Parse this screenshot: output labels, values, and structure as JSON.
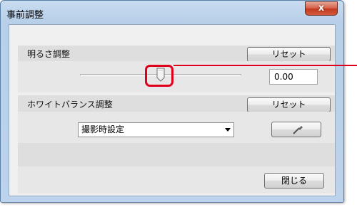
{
  "window": {
    "title": "事前調整",
    "close_label": "x"
  },
  "brightness": {
    "label": "明るさ調整",
    "reset_label": "リセット",
    "value": "0.00",
    "slider_position": 0.5
  },
  "white_balance": {
    "label": "ホワイトバランス調整",
    "reset_label": "リセット",
    "selected_option": "撮影時設定"
  },
  "footer": {
    "close_button_label": "閉じる"
  },
  "icons": {
    "eyedropper": "eyedropper-icon",
    "dropdown": "chevron-down-icon",
    "slider_thumb": "slider-thumb"
  },
  "colors": {
    "highlight": "#e0001b",
    "close_button": "#c2391d",
    "titlebar": "#b7cfe8"
  }
}
